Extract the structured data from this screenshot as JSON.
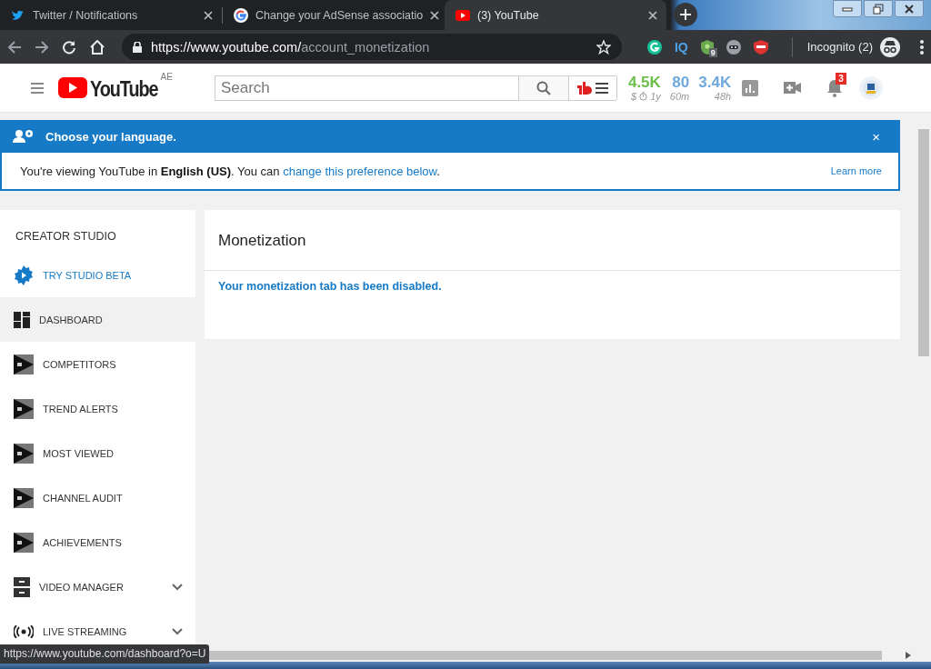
{
  "browser": {
    "tabs": [
      {
        "title": "Twitter / Notifications",
        "kind": "bird",
        "selected": false
      },
      {
        "title": "Change your AdSense associatio",
        "kind": "g",
        "selected": false
      },
      {
        "title": "(3) YouTube",
        "kind": "play",
        "selected": true
      }
    ],
    "url_host": "https://www.youtube.com/",
    "url_path": "account_monetization",
    "extensions": [
      {
        "kind": "grammar"
      },
      {
        "kind": "text",
        "label": "IQ"
      },
      {
        "kind": "shield",
        "badge": "9"
      },
      {
        "kind": "ninja"
      },
      {
        "kind": "wab"
      }
    ],
    "profile": "Incognito (2)"
  },
  "masthead": {
    "logo": "YouTube",
    "region": "AE",
    "search_placeholder": "Search",
    "stats": [
      {
        "value": "4.5K",
        "prefix": "$",
        "timer": true,
        "caption": "1y",
        "color": "#6cbf4b"
      },
      {
        "value": "80",
        "timer": false,
        "caption": "60m",
        "color": "#6fa8dc"
      },
      {
        "value": "3.4K",
        "timer": false,
        "caption": "48h",
        "color": "#6fa8dc"
      }
    ],
    "notifications": "3"
  },
  "banner": {
    "title": "Choose your language.",
    "message": "You're viewing YouTube in **English (US)**. You can ",
    "link": "change this preference below",
    "message_end": ".",
    "learn_more": "Learn more",
    "close": "×"
  },
  "sidebar": {
    "heading": "CREATOR STUDIO",
    "items": [
      {
        "label": "TRY STUDIO BETA",
        "kind": "beta",
        "selected": false,
        "expandable": false
      },
      {
        "label": "DASHBOARD",
        "kind": "dashboard",
        "selected": true,
        "expandable": false
      },
      {
        "label": "COMPETITORS",
        "kind": "iq",
        "selected": false,
        "expandable": false
      },
      {
        "label": "TREND ALERTS",
        "kind": "iq",
        "selected": false,
        "expandable": false
      },
      {
        "label": "MOST VIEWED",
        "kind": "iq",
        "selected": false,
        "expandable": false
      },
      {
        "label": "CHANNEL AUDIT",
        "kind": "iq",
        "selected": false,
        "expandable": false
      },
      {
        "label": "ACHIEVEMENTS",
        "kind": "iq",
        "selected": false,
        "expandable": false
      },
      {
        "label": "VIDEO MANAGER",
        "kind": "manager",
        "selected": false,
        "expandable": true
      },
      {
        "label": "LIVE STREAMING",
        "kind": "live",
        "selected": false,
        "expandable": true
      }
    ]
  },
  "content": {
    "title": "Monetization",
    "message": "Your monetization tab has been disabled."
  },
  "status_url": "https://www.youtube.com/dashboard?o=U"
}
